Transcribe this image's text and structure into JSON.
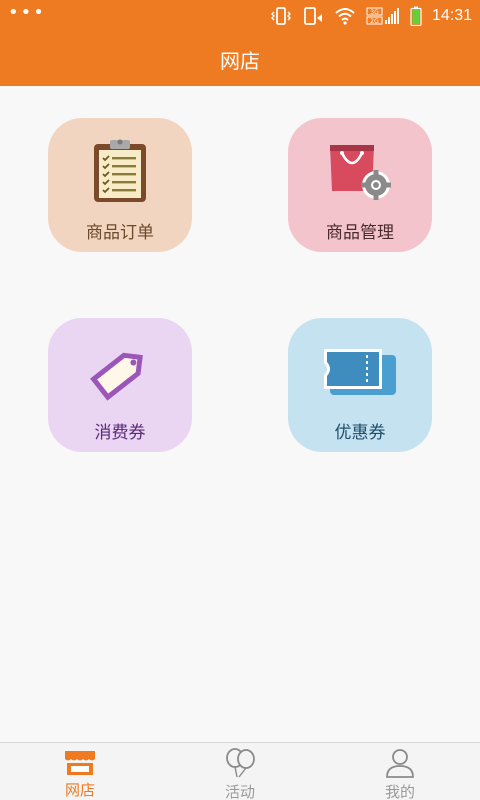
{
  "status_bar": {
    "time": "14:31",
    "network_label": "3G 2G"
  },
  "header": {
    "title": "网店"
  },
  "tiles": [
    {
      "label": "商品订单",
      "icon": "clipboard-icon"
    },
    {
      "label": "商品管理",
      "icon": "shopping-bag-gear-icon"
    },
    {
      "label": "消费券",
      "icon": "tag-icon"
    },
    {
      "label": "优惠券",
      "icon": "ticket-icon"
    }
  ],
  "bottom_nav": {
    "items": [
      {
        "label": "网店",
        "icon": "storefront-icon",
        "active": true
      },
      {
        "label": "活动",
        "icon": "balloons-icon",
        "active": false
      },
      {
        "label": "我的",
        "icon": "user-icon",
        "active": false
      }
    ]
  },
  "colors": {
    "brand": "#ee7a21",
    "tile_orders": "#f2d5c0",
    "tile_goods": "#f4c4cc",
    "tile_voucher": "#ead5f2",
    "tile_coupon": "#c5e2f0"
  }
}
